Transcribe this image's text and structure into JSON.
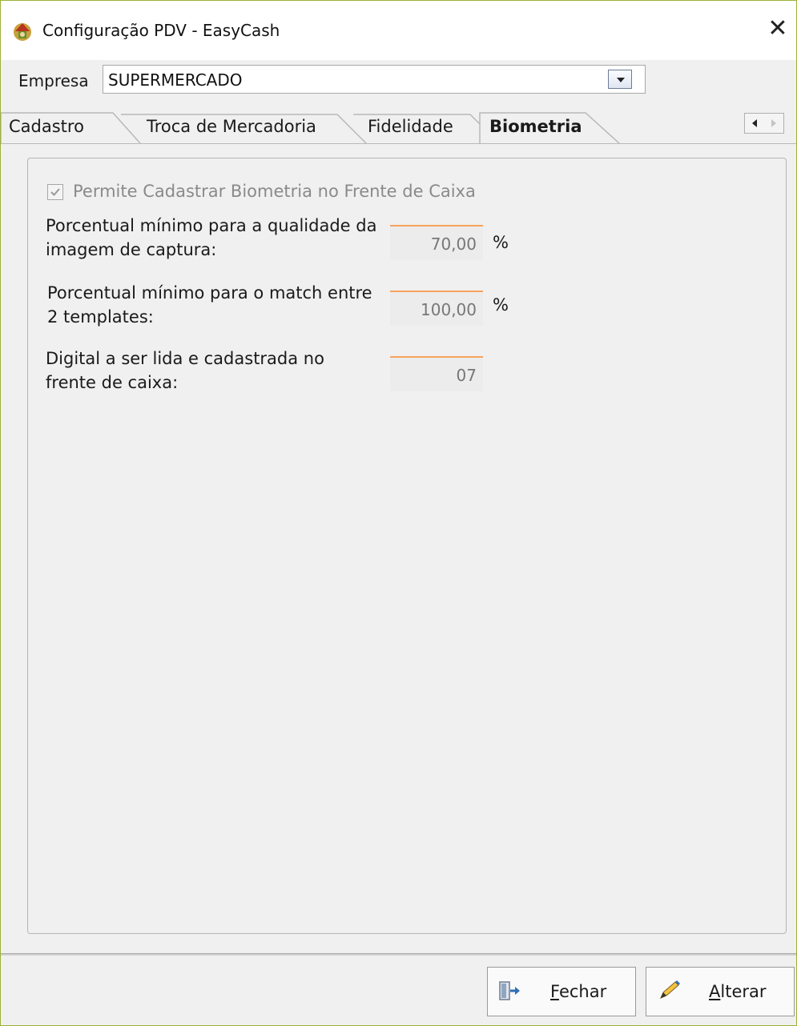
{
  "window": {
    "title": "Configuração PDV - EasyCash",
    "close_label": "✕"
  },
  "empresa": {
    "label": "Empresa",
    "value": "SUPERMERCADO"
  },
  "tabs": [
    {
      "label": "Cadastro",
      "active": false
    },
    {
      "label": "Troca de Mercadoria",
      "active": false
    },
    {
      "label": "Fidelidade",
      "active": false
    },
    {
      "label": "Biometria",
      "active": true
    }
  ],
  "biometria": {
    "checkbox_label": "Permite Cadastrar Biometria no Frente de Caixa",
    "checkbox_checked": true,
    "fields": [
      {
        "label_line1": "Porcentual mínimo para a qualidade da",
        "label_line2": "imagem de captura:",
        "value": "70,00",
        "unit": "%"
      },
      {
        "label_line1": "Porcentual mínimo para o match entre",
        "label_line2": "2 templates:",
        "value": "100,00",
        "unit": "%"
      },
      {
        "label_line1": "Digital a ser lida e cadastrada no",
        "label_line2": "frente de caixa:",
        "value": "07",
        "unit": ""
      }
    ]
  },
  "buttons": {
    "fechar": {
      "mnemonic": "F",
      "rest": "echar",
      "icon": "exit-door-icon"
    },
    "alterar": {
      "mnemonic": "A",
      "rest": "lterar",
      "icon": "pencil-icon"
    }
  },
  "colors": {
    "window_border": "#9ab43a",
    "field_accent": "#f6a35c"
  }
}
